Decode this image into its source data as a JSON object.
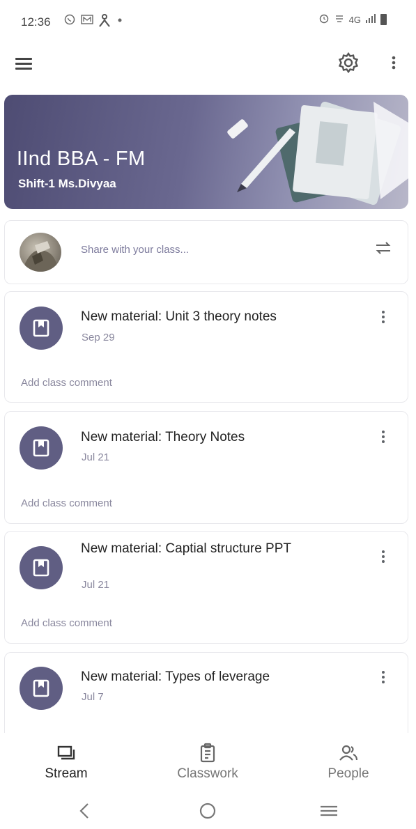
{
  "status_bar": {
    "time": "12:36",
    "left_icons": [
      "whatsapp-icon",
      "mail-icon",
      "accessibility-icon",
      "dot-icon"
    ],
    "right_text": "4G",
    "right_icons": [
      "alarm-icon",
      "volte-icon",
      "signal-icon",
      "battery-icon"
    ]
  },
  "app_bar": {
    "icons": [
      "menu-icon",
      "gear-icon",
      "more-vertical-icon"
    ]
  },
  "banner": {
    "title": "IInd BBA - FM",
    "subtitle": "Shift-1 Ms.Divyaa"
  },
  "share": {
    "placeholder": "Share with your class..."
  },
  "posts": [
    {
      "title": "New material: Unit 3 theory notes",
      "date": "Sep 29",
      "comment": "Add class comment"
    },
    {
      "title": "New material: Theory Notes",
      "date": "Jul 21",
      "comment": "Add class comment"
    },
    {
      "title": "New material: Captial structure PPT",
      "date": "Jul 21",
      "comment": "Add class comment"
    },
    {
      "title": "New material: Types of leverage",
      "date": "Jul 7"
    }
  ],
  "bottom_nav": {
    "items": [
      {
        "label": "Stream",
        "icon": "stream-icon",
        "active": true
      },
      {
        "label": "Classwork",
        "icon": "clipboard-icon",
        "active": false
      },
      {
        "label": "People",
        "icon": "people-icon",
        "active": false
      }
    ]
  },
  "colors": {
    "banner": "#5f5d86",
    "post_icon": "#605e83",
    "accent_text": "#7c7a9c"
  }
}
